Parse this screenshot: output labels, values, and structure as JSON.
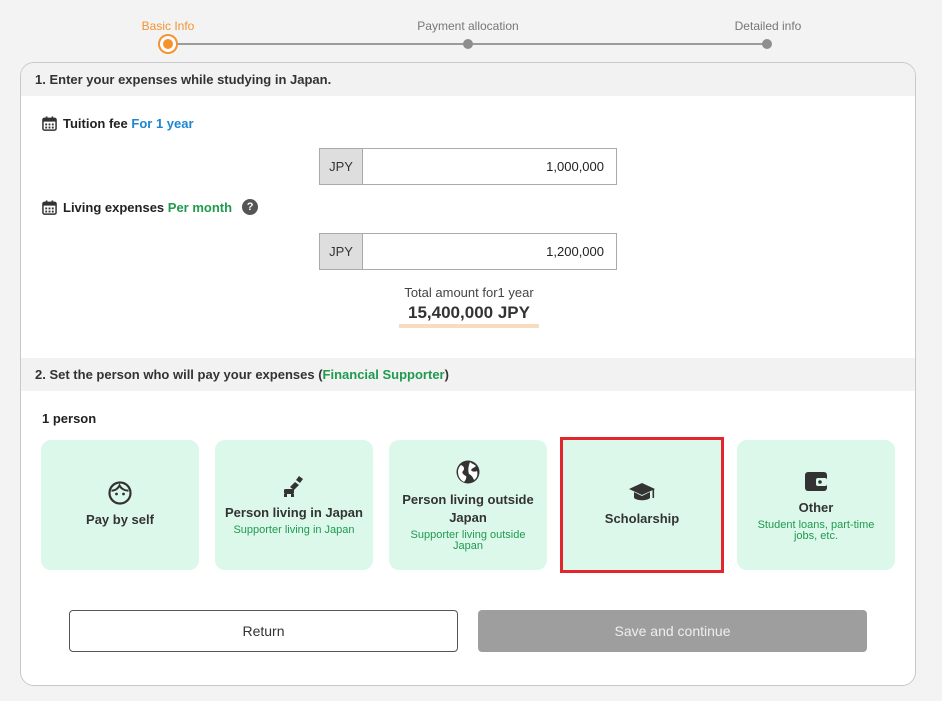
{
  "stepper": {
    "steps": [
      {
        "label": "Basic Info",
        "active": true
      },
      {
        "label": "Payment allocation",
        "active": false
      },
      {
        "label": "Detailed info",
        "active": false
      }
    ],
    "active_color": "#f5922e"
  },
  "section1": {
    "title": "1. Enter your expenses while studying in Japan.",
    "tuition": {
      "label": "Tuition fee",
      "period": "For 1 year",
      "currency": "JPY",
      "value": "1,000,000",
      "icon": "calendar-icon"
    },
    "living": {
      "label": "Living expenses",
      "period": "Per month",
      "currency": "JPY",
      "value": "1,200,000",
      "icon": "calendar-icon",
      "help": "?"
    },
    "total": {
      "label": "Total amount for1 year",
      "value": "15,400,000 JPY"
    }
  },
  "section2": {
    "title_prefix": "2. Set the person who will pay your expenses (",
    "title_highlight": "Financial Supporter",
    "title_suffix": ")",
    "count": "1 person",
    "options": [
      {
        "title": "Pay by self",
        "sub": "",
        "icon": "face-icon"
      },
      {
        "title": "Person living in Japan",
        "sub": "Supporter living in Japan",
        "icon": "person-seated-icon"
      },
      {
        "title": "Person living outside Japan",
        "sub": "Supporter living outside Japan",
        "icon": "globe-icon"
      },
      {
        "title": "Scholarship",
        "sub": "",
        "icon": "graduation-cap-icon",
        "selected": true
      },
      {
        "title": "Other",
        "sub": "Student loans, part-time jobs, etc.",
        "icon": "wallet-icon"
      }
    ]
  },
  "buttons": {
    "return": "Return",
    "save": "Save and continue"
  },
  "colors": {
    "green": "#1f9a4f",
    "blue": "#1c86d1",
    "option_bg": "#dcf8ea",
    "selected_border": "#e3262d"
  }
}
